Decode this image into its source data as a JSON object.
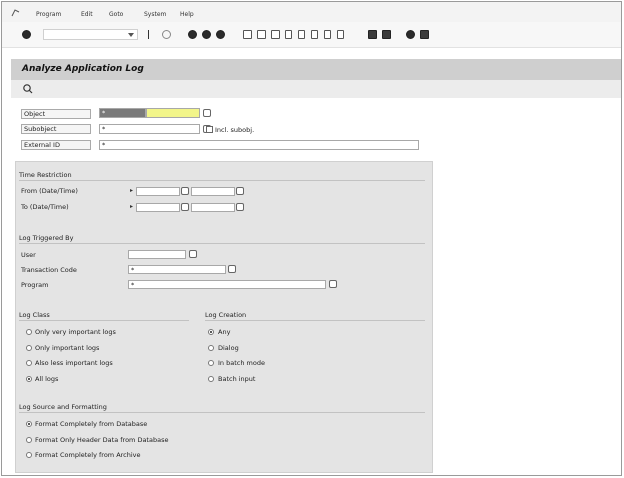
{
  "menu": {
    "items": [
      "Program",
      "Edit",
      "Goto",
      "System",
      "Help"
    ]
  },
  "page_title": "Analyze Application Log",
  "fields": {
    "object": {
      "label": "Object",
      "value": "*",
      "input2": ""
    },
    "subobject": {
      "label": "Subobject",
      "value": "*",
      "checkbox_label": "Incl. subobj."
    },
    "external_id": {
      "label": "External ID",
      "value": "*"
    }
  },
  "time_restriction": {
    "title": "Time Restriction",
    "from_label": "From (Date/Time)",
    "to_label": "To (Date/Time)",
    "from_date": "",
    "from_time": "",
    "to_date": "",
    "to_time": ""
  },
  "log_triggered_by": {
    "title": "Log Triggered By",
    "user_label": "User",
    "user_value": "",
    "tcode_label": "Transaction Code",
    "tcode_value": "*",
    "program_label": "Program",
    "program_value": "*"
  },
  "log_class": {
    "title": "Log Class",
    "options": [
      "Only very important logs",
      "Only important logs",
      "Also less important logs",
      "All logs"
    ],
    "selected": 3
  },
  "log_creation": {
    "title": "Log Creation",
    "options": [
      "Any",
      "Dialog",
      "In batch mode",
      "Batch input"
    ],
    "selected": 0
  },
  "log_source": {
    "title": "Log Source and Formatting",
    "options": [
      "Format Completely from Database",
      "Format Only Header Data from Database",
      "Format Completely from Archive"
    ],
    "selected": 0
  }
}
